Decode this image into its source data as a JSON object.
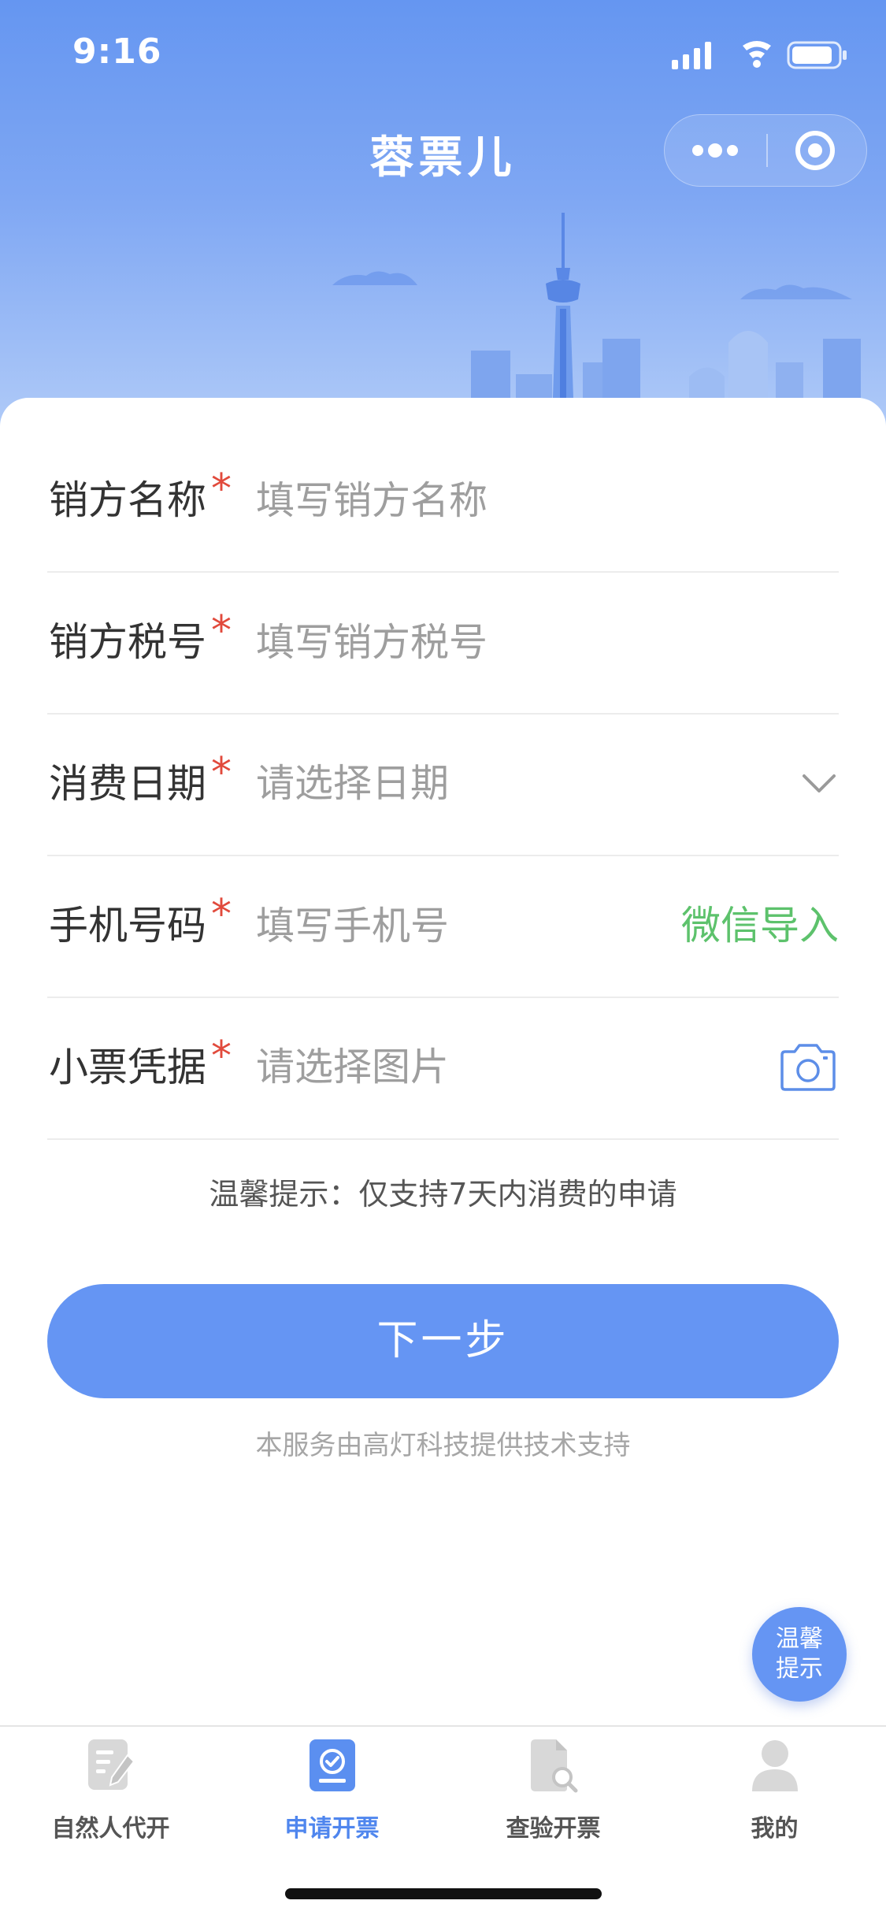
{
  "status_bar": {
    "time": "9:16"
  },
  "header": {
    "title": "蓉票儿",
    "more_icon": "more-dots-icon",
    "close_icon": "target-circle-icon"
  },
  "form": {
    "fields": [
      {
        "label": "销方名称",
        "required": "*",
        "placeholder": "填写销方名称"
      },
      {
        "label": "销方税号",
        "required": "*",
        "placeholder": "填写销方税号"
      },
      {
        "label": "消费日期",
        "required": "*",
        "placeholder": "请选择日期"
      },
      {
        "label": "手机号码",
        "required": "*",
        "placeholder": "填写手机号",
        "action": "微信导入"
      },
      {
        "label": "小票凭据",
        "required": "*",
        "placeholder": "请选择图片"
      }
    ],
    "tip": "温馨提示：仅支持7天内消费的申请",
    "next_label": "下一步",
    "powered_by": "本服务由高灯科技提供技术支持"
  },
  "float_tip": {
    "line1": "温馨",
    "line2": "提示"
  },
  "tabbar": {
    "items": [
      {
        "label": "自然人代开",
        "icon": "document-edit-icon"
      },
      {
        "label": "申请开票",
        "icon": "invoice-check-icon",
        "active": true
      },
      {
        "label": "查验开票",
        "icon": "document-search-icon"
      },
      {
        "label": "我的",
        "icon": "user-icon"
      }
    ]
  },
  "colors": {
    "primary": "#6595f3",
    "header_top": "#6596f1",
    "required": "#e14a3c",
    "wechat_green": "#5dc26c",
    "tab_active": "#4f86ee"
  }
}
